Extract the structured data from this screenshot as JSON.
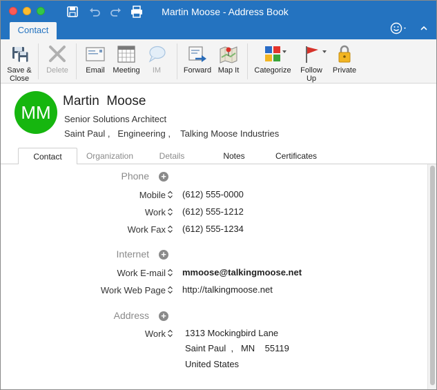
{
  "window": {
    "title": "Martin Moose - Address Book"
  },
  "ribbon_tab": "Contact",
  "ribbon": {
    "save_close": "Save & Close",
    "delete": "Delete",
    "email": "Email",
    "meeting": "Meeting",
    "im": "IM",
    "forward": "Forward",
    "map_it": "Map It",
    "categorize": "Categorize",
    "follow_up": "Follow Up",
    "private": "Private"
  },
  "contact": {
    "initials": "MM",
    "first_name": "Martin",
    "last_name": "Moose",
    "job_title": "Senior Solutions Architect",
    "city": "Saint Paul",
    "department": "Engineering",
    "company": "Talking Moose Industries",
    "avatar_color": "#16b60f"
  },
  "tabs": [
    "Contact",
    "Organization",
    "Details",
    "Notes",
    "Certificates"
  ],
  "phone": {
    "heading": "Phone",
    "rows": [
      {
        "label": "Mobile",
        "value": "(612) 555-0000"
      },
      {
        "label": "Work",
        "value": "(612) 555-1212"
      },
      {
        "label": "Work Fax",
        "value": "(612) 555-1234"
      }
    ]
  },
  "internet": {
    "heading": "Internet",
    "rows": [
      {
        "label": "Work E-mail",
        "value": "mmoose@talkingmoose.net"
      },
      {
        "label": "Work Web Page",
        "value": "http://talkingmoose.net"
      }
    ]
  },
  "address": {
    "heading": "Address",
    "label": "Work",
    "street": "1313 Mockingbird Lane",
    "city": "Saint Paul",
    "state": "MN",
    "zip": "55119",
    "country": "United States"
  },
  "colors": {
    "accent": "#2473c0",
    "ribbon_bg": "#f4f4f4"
  }
}
